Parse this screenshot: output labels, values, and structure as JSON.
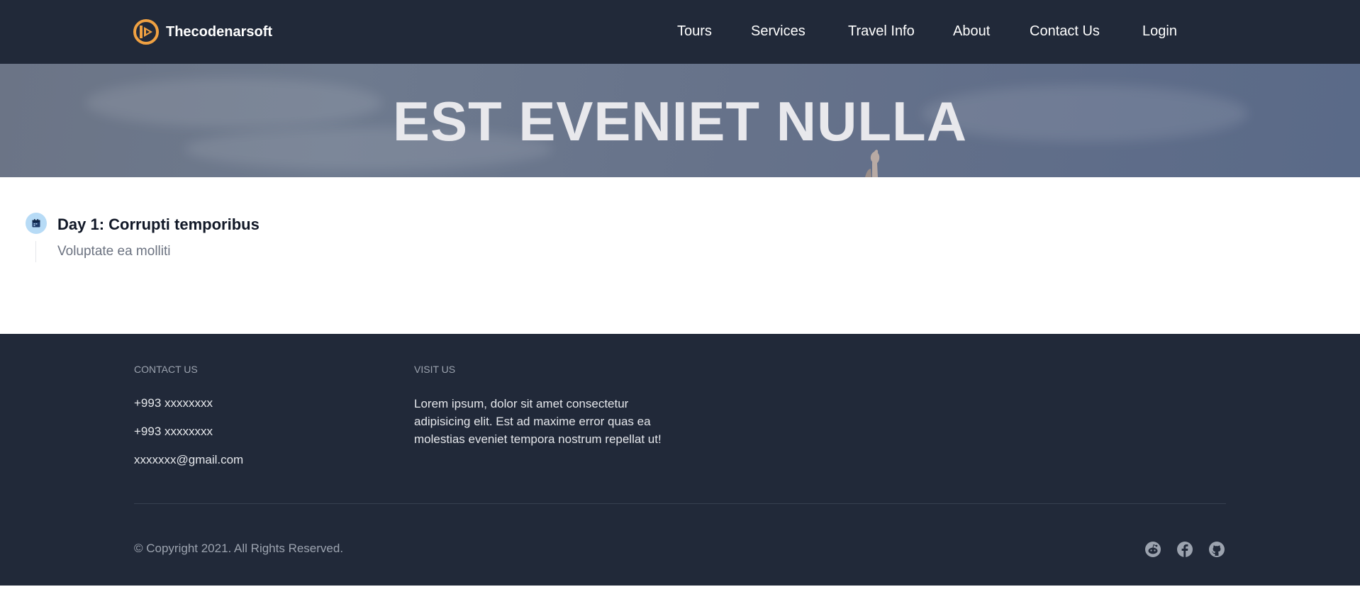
{
  "header": {
    "brand": "Thecodenarsoft",
    "nav": [
      {
        "label": "Tours"
      },
      {
        "label": "Services"
      },
      {
        "label": "Travel Info"
      },
      {
        "label": "About"
      },
      {
        "label": "Contact Us"
      },
      {
        "label": "Login"
      }
    ]
  },
  "hero": {
    "title": "EST EVENIET NULLA"
  },
  "itinerary": {
    "days": [
      {
        "title": "Day 1: Corrupti temporibus",
        "description": "Voluptate ea molliti",
        "icon": "calendar-icon"
      }
    ]
  },
  "footer": {
    "contact": {
      "heading": "CONTACT US",
      "phone1": "+993 xxxxxxxx",
      "phone2": "+993 xxxxxxxx",
      "email": "xxxxxxx@gmail.com"
    },
    "visit": {
      "heading": "VISIT US",
      "text": "Lorem ipsum, dolor sit amet consectetur adipisicing elit. Est ad maxime error quas ea molestias eveniet tempora nostrum repellat ut!"
    },
    "copyright": "© Copyright 2021. All Rights Reserved.",
    "social": [
      "reddit-icon",
      "facebook-icon",
      "github-icon"
    ]
  },
  "colors": {
    "header_bg": "#212939",
    "footer_bg": "#212939",
    "logo_orange": "#f0a142",
    "day_icon_bg": "#b7dbf6"
  }
}
